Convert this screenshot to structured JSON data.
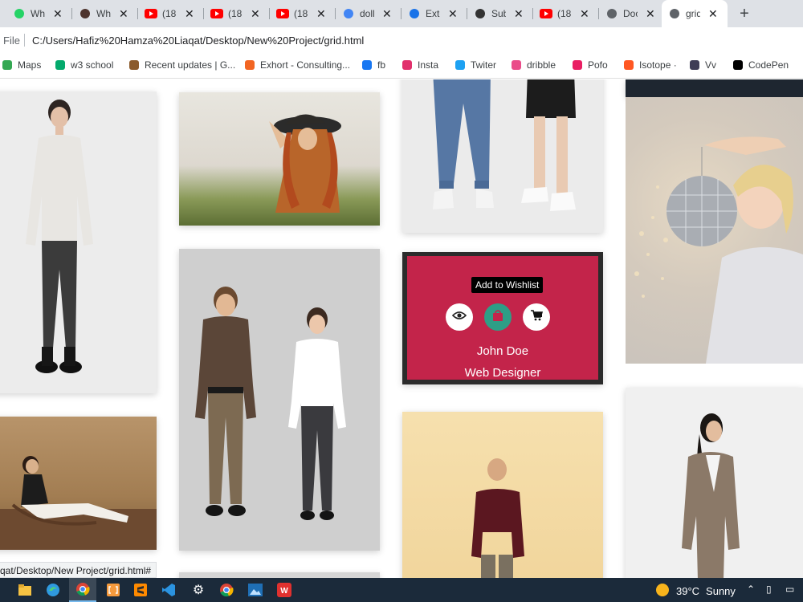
{
  "tabs": [
    {
      "title": "Wh",
      "icon": "whatsapp-icon",
      "color": "#25d366"
    },
    {
      "title": "Wh",
      "icon": "wand-icon",
      "color": "#4e342e"
    },
    {
      "title": "(18",
      "icon": "youtube-icon",
      "color": "#ff0000"
    },
    {
      "title": "(18",
      "icon": "youtube-icon",
      "color": "#ff0000"
    },
    {
      "title": "(18",
      "icon": "youtube-icon",
      "color": "#ff0000"
    },
    {
      "title": "doll",
      "icon": "google-icon",
      "color": "#4285f4"
    },
    {
      "title": "Exte",
      "icon": "puzzle-icon",
      "color": "#1a73e8"
    },
    {
      "title": "Sub",
      "icon": "bracket-icon",
      "color": "#333333"
    },
    {
      "title": "(18",
      "icon": "youtube-icon",
      "color": "#ff0000"
    },
    {
      "title": "Doc",
      "icon": "globe-icon",
      "color": "#5f6368"
    },
    {
      "title": "grid",
      "icon": "globe-icon",
      "color": "#5f6368"
    }
  ],
  "address": {
    "scheme": "File",
    "url": "C:/Users/Hafiz%20Hamza%20Liaqat/Desktop/New%20Project/grid.html"
  },
  "bookmarks": [
    {
      "label": "Maps",
      "icon": "maps-icon",
      "color": "#34a853"
    },
    {
      "label": "w3 school",
      "icon": "w3schools-icon",
      "color": "#04aa6d"
    },
    {
      "label": "Recent updates | G...",
      "icon": "goodreads-icon",
      "color": "#8b5a2b"
    },
    {
      "label": "Exhort - Consulting...",
      "icon": "exhort-icon",
      "color": "#f26522"
    },
    {
      "label": "fb",
      "icon": "facebook-icon",
      "color": "#1877f2"
    },
    {
      "label": "Insta",
      "icon": "instagram-icon",
      "color": "#e1306c"
    },
    {
      "label": "Twiter",
      "icon": "twitter-icon",
      "color": "#1da1f2"
    },
    {
      "label": "dribble",
      "icon": "dribbble-icon",
      "color": "#ea4c89"
    },
    {
      "label": "Pofo",
      "icon": "asterisk-icon",
      "color": "#e91e63"
    },
    {
      "label": "Isotope ·",
      "icon": "isotope-icon",
      "color": "#ff5722"
    },
    {
      "label": "Vv",
      "icon": "v-icon",
      "color": "#3f3d56"
    },
    {
      "label": "CodePen",
      "icon": "codepen-icon",
      "color": "#000000"
    }
  ],
  "overlay": {
    "tooltip": "Add to Wishlist",
    "name": "John Doe",
    "role": "Web Designer",
    "accent": "#c3244a",
    "wishlist_color": "#2e9e86"
  },
  "status_url": "qat/Desktop/New Project/grid.html#",
  "taskbar": {
    "temperature": "39°C",
    "condition": "Sunny"
  }
}
